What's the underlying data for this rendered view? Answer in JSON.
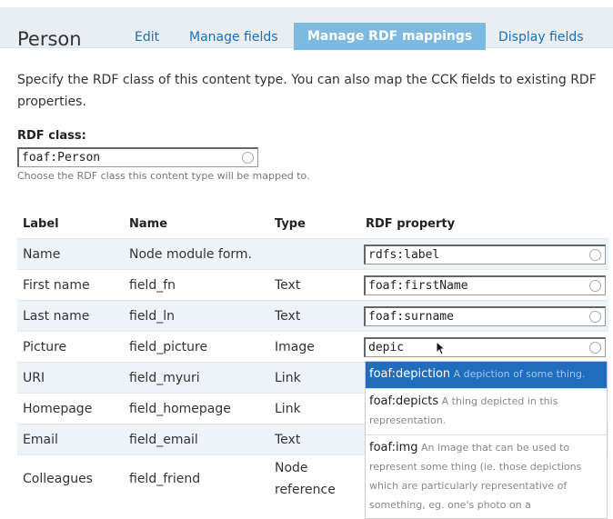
{
  "header": {
    "title": "Person",
    "tabs": [
      {
        "label": "Edit"
      },
      {
        "label": "Manage fields"
      },
      {
        "label": "Manage RDF mappings"
      },
      {
        "label": "Display fields"
      }
    ]
  },
  "intro": "Specify the RDF class of this content type. You can also map the CCK fields to existing RDF properties.",
  "rdf_class": {
    "label": "RDF class:",
    "value": "foaf:Person",
    "help": "Choose the RDF class this content type will be mapped to."
  },
  "table": {
    "headers": [
      "Label",
      "Name",
      "Type",
      "RDF property"
    ],
    "rows": [
      {
        "label": "Name",
        "name": "Node module form.",
        "type": "",
        "rdf": "rdfs:label"
      },
      {
        "label": "First name",
        "name": "field_fn",
        "type": "Text",
        "rdf": "foaf:firstName"
      },
      {
        "label": "Last name",
        "name": "field_ln",
        "type": "Text",
        "rdf": "foaf:surname"
      },
      {
        "label": "Picture",
        "name": "field_picture",
        "type": "Image",
        "rdf": "depic"
      },
      {
        "label": "URI",
        "name": "field_myuri",
        "type": "Link",
        "rdf": ""
      },
      {
        "label": "Homepage",
        "name": "field_homepage",
        "type": "Link",
        "rdf": ""
      },
      {
        "label": "Email",
        "name": "field_email",
        "type": "Text",
        "rdf": ""
      },
      {
        "label": "Colleagues",
        "name": "field_friend",
        "type": "Node reference",
        "rdf": ""
      }
    ]
  },
  "autocomplete": {
    "suggestions": [
      {
        "key": "foaf:depiction",
        "desc": "A depiction of some thing."
      },
      {
        "key": "foaf:depicts",
        "desc": "A thing depicted in this representation."
      },
      {
        "key": "foaf:img",
        "desc": "An image that can be used to represent some thing (ie. those depictions which are particularly representative of something, eg. one's photo on a"
      }
    ]
  },
  "colors": {
    "active_tab": "#7eb9df",
    "link": "#1d6fb8",
    "selected_suggestion": "#1f6ebd"
  },
  "icons": [
    "throbber-circle-icon",
    "mouse-cursor-icon"
  ]
}
